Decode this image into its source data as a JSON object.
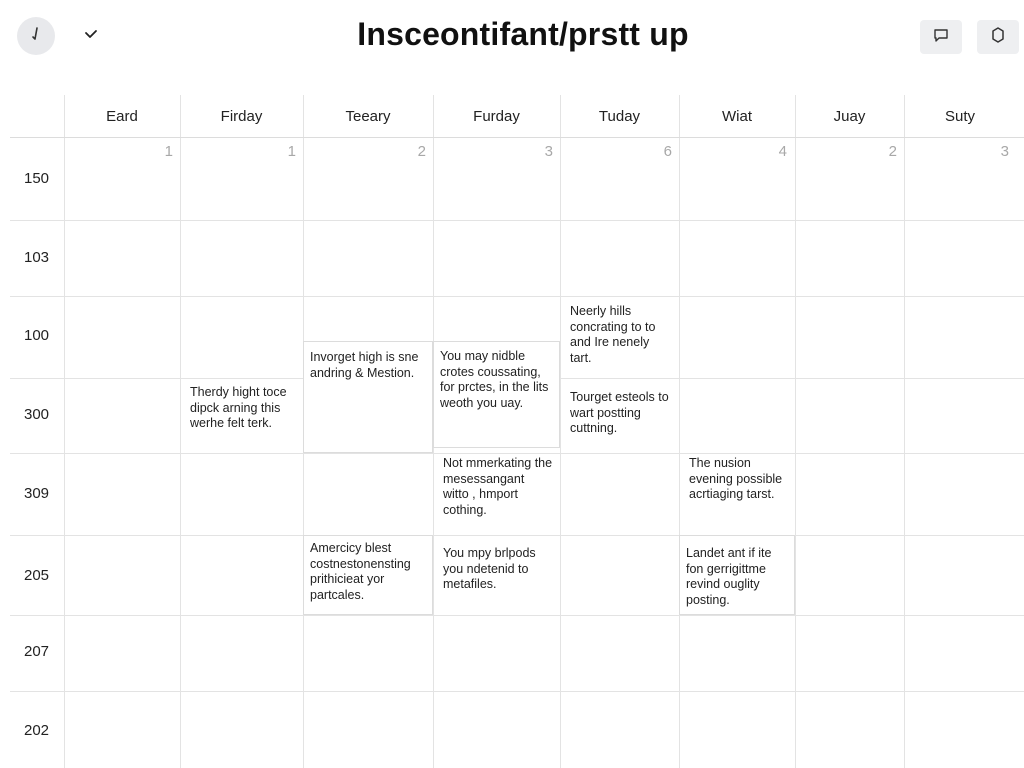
{
  "header": {
    "title": "Insceontifant/prstt up",
    "avatar_icon": "pen-icon",
    "chevron_icon": "chevron-down-icon",
    "chat_icon": "chat-icon",
    "gear_icon": "gear-icon"
  },
  "days": [
    {
      "label": "Eard",
      "num": ""
    },
    {
      "label": "Firday",
      "num": "1"
    },
    {
      "label": "Teeary",
      "num": "1"
    },
    {
      "label": "Furday",
      "num": "2"
    },
    {
      "label": "Tuday",
      "num": "3"
    },
    {
      "label": "Wiat",
      "num": "6"
    },
    {
      "label": "Juay",
      "num": "4"
    },
    {
      "label": "Suty",
      "num": "2"
    },
    {
      "label": "",
      "num": "3"
    }
  ],
  "rows": [
    "150",
    "103",
    "100",
    "300",
    "309",
    "205",
    "207",
    "202"
  ],
  "events": {
    "e1": "Therdy hight toce dipck arning this werhe felt terk.",
    "e2": "Invorget high is sne andring & Mestion.",
    "e3": "You may nidble crotes coussating, for prctes, in the lits weoth you uay.",
    "e4": "Neerly hills concrating to to and Ire nenely tart.",
    "e5": "Tourget esteols to wart postting cuttning.",
    "e6": "Not mmerkating the mesessangant witto , hmport cothing.",
    "e7": "The nusion evening possible acrtiaging tarst.",
    "e8": "Amercicy blest costnestonensting prithicieat yor partcales.",
    "e9": "You mpy brlpods you ndetenid to metafiles.",
    "e10": "Landet ant if ite fon gerrigittme revind ouglity posting."
  }
}
